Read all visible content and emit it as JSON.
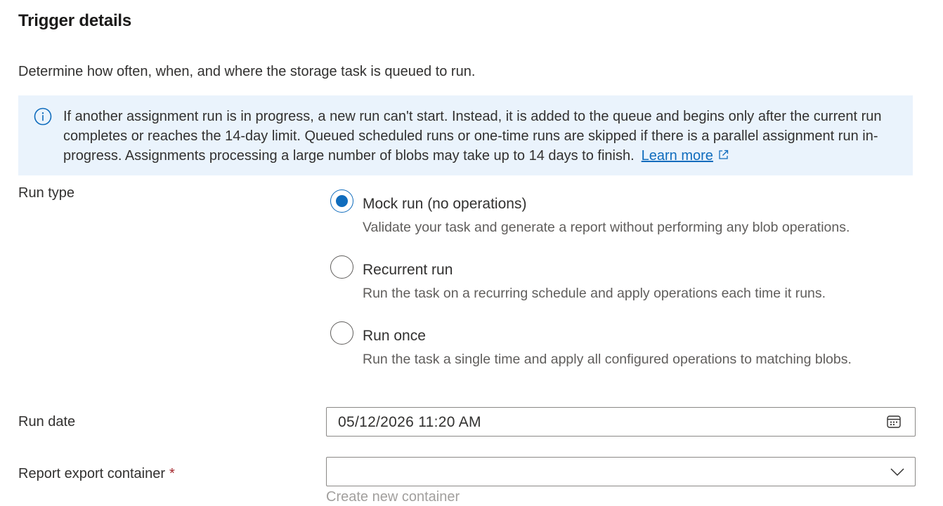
{
  "section": {
    "title": "Trigger details",
    "description": "Determine how often, when, and where the storage task is queued to run."
  },
  "info": {
    "icon": "info-icon",
    "text": "If another assignment run is in progress, a new run can't start. Instead, it is added to the queue and begins only after the current run completes or reaches the 14-day limit. Queued scheduled runs or one-time runs are skipped if there is a parallel assignment run in-progress. Assignments processing a large number of blobs may take up to 14 days to finish.",
    "link_label": "Learn more",
    "link_icon": "external-link-icon"
  },
  "run_type": {
    "label": "Run type",
    "selected": "mock",
    "options": [
      {
        "id": "mock",
        "label": "Mock run (no operations)",
        "description": "Validate your task and generate a report without performing any blob operations."
      },
      {
        "id": "recurrent",
        "label": "Recurrent run",
        "description": "Run the task on a recurring schedule and apply operations each time it runs."
      },
      {
        "id": "once",
        "label": "Run once",
        "description": "Run the task a single time and apply all configured operations to matching blobs."
      }
    ]
  },
  "run_date": {
    "label": "Run date",
    "value": "05/12/2026 11:20 AM",
    "icon": "calendar-icon"
  },
  "report_container": {
    "label": "Report export container",
    "required_mark": "*",
    "value": "",
    "icon": "chevron-down-icon",
    "create_label": "Create new container"
  },
  "colors": {
    "accent": "#0f6cbd",
    "info_background": "#eaf3fc",
    "required": "#a4262c"
  }
}
